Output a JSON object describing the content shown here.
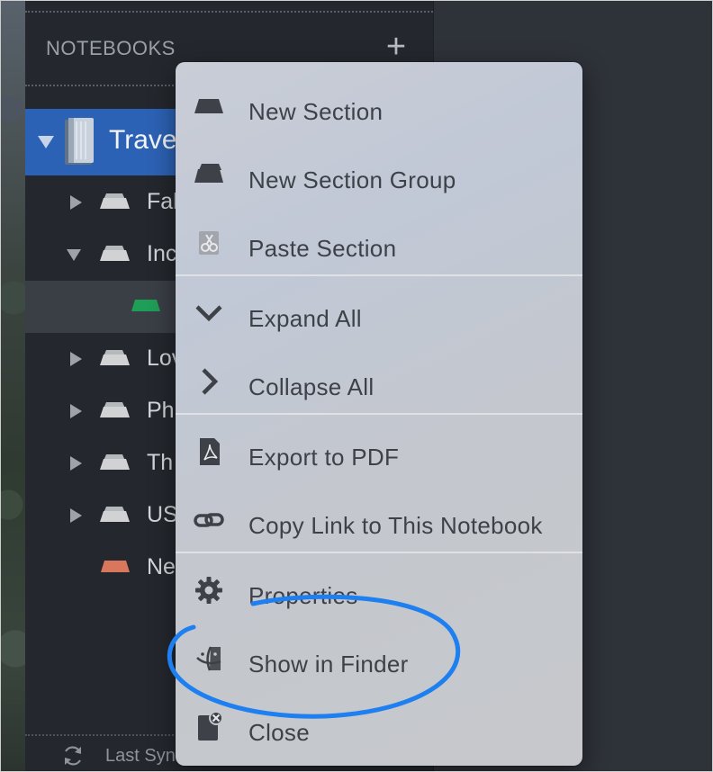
{
  "sidebar": {
    "header": "NOTEBOOKS",
    "add_symbol": "+",
    "notebook": {
      "name": "Trave"
    },
    "sections": [
      {
        "label": "Fal",
        "expander": "collapsed",
        "color": "#d0d2d4"
      },
      {
        "label": "Inc",
        "expander": "expanded",
        "color": "#d0d2d4"
      },
      {
        "label": "",
        "expander": "none",
        "color": "#1f9e57",
        "selected": true
      },
      {
        "label": "Lov",
        "expander": "collapsed",
        "color": "#d0d2d4"
      },
      {
        "label": "Ph",
        "expander": "collapsed",
        "color": "#d0d2d4"
      },
      {
        "label": "Th",
        "expander": "collapsed",
        "color": "#d0d2d4"
      },
      {
        "label": "US",
        "expander": "collapsed",
        "color": "#d0d2d4"
      },
      {
        "label": "Ne",
        "expander": "none",
        "color": "#d9775c"
      }
    ],
    "footer_text": "Last Syn"
  },
  "menu": {
    "items": [
      {
        "label": "New Section",
        "icon": "section-icon"
      },
      {
        "label": "New Section Group",
        "icon": "section-group-icon"
      },
      {
        "label": "Paste Section",
        "icon": "paste-icon"
      },
      {
        "label": "Expand All",
        "icon": "chevron-down-icon"
      },
      {
        "label": "Collapse All",
        "icon": "chevron-right-icon"
      },
      {
        "label": "Export to PDF",
        "icon": "pdf-icon"
      },
      {
        "label": "Copy Link to This Notebook",
        "icon": "link-icon"
      },
      {
        "label": "Properties",
        "icon": "gear-icon"
      },
      {
        "label": "Show in Finder",
        "icon": "finder-icon"
      },
      {
        "label": "Close",
        "icon": "close-notebook-icon"
      }
    ]
  },
  "colors": {
    "accent": "#2c62b5",
    "annotation": "#1e7ff0"
  }
}
